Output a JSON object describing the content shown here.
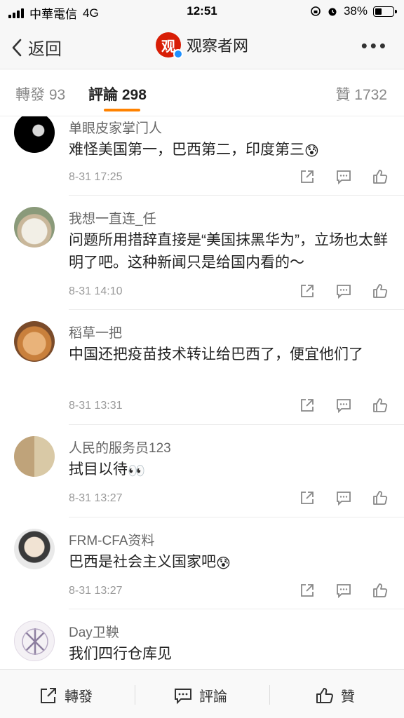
{
  "status_bar": {
    "carrier": "中華電信",
    "network": "4G",
    "time": "12:51",
    "battery_pct": "38%",
    "battery_level": 0.38
  },
  "nav": {
    "back_label": "返回",
    "title": "观察者网",
    "logo_char": "观",
    "more_label": "•••"
  },
  "tabs": {
    "repost": "轉發 93",
    "comment": "評論 298",
    "like": "贊 1732"
  },
  "comments": [
    {
      "name": "单眼皮家掌门人",
      "text": "难怪美国第一，巴西第二，印度第三",
      "emoji": "😰",
      "date": "8-31 17:25"
    },
    {
      "name": "我想一直连_任",
      "text": "问题所用措辞直接是“美国抹黑华为”，立场也太鲜明了吧。这种新闻只是给国内看的～",
      "emoji": "",
      "date": "8-31 14:10"
    },
    {
      "name": "稻草一把",
      "text": "中国还把疫苗技术转让给巴西了，便宜他们了",
      "emoji": "",
      "date": "8-31 13:31"
    },
    {
      "name": "人民的服务员123",
      "text": "拭目以待",
      "emoji": "👀",
      "date": "8-31 13:27"
    },
    {
      "name": "FRM-CFA资料",
      "text": "巴西是社会主义国家吧",
      "emoji": "😰",
      "date": "8-31 13:27"
    },
    {
      "name": "Day卫鞅",
      "text": "我们四行仓库见",
      "emoji": "",
      "date": ""
    }
  ],
  "bottom_bar": {
    "repost": "轉發",
    "comment": "評論",
    "like": "贊"
  }
}
